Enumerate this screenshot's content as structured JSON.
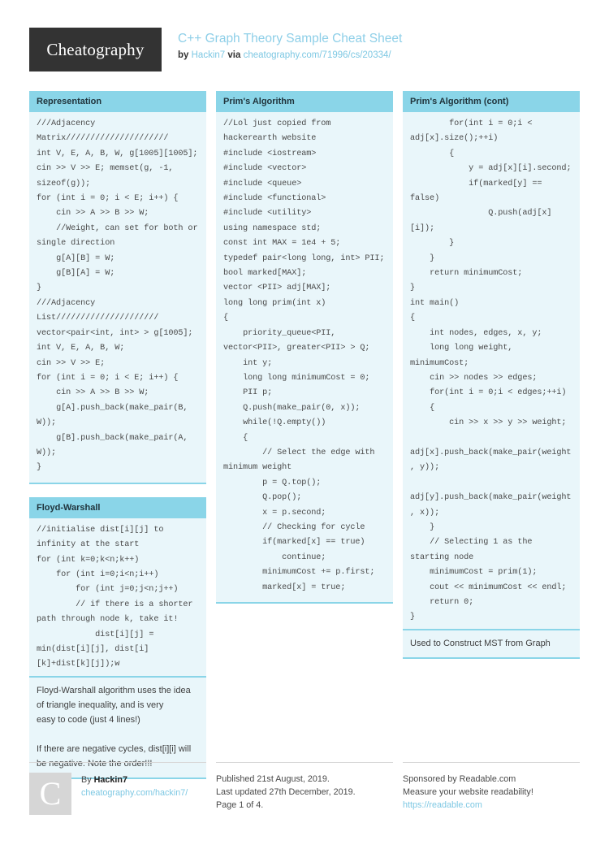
{
  "header": {
    "logo_text": "Cheatography",
    "title": "C++ Graph Theory Sample Cheat Sheet",
    "by_label": "by",
    "author": "Hackin7",
    "via_label": "via",
    "source_url": "cheatography.com/71996/cs/20334/",
    "accent_color": "#8ad5e8",
    "logo_bg": "#333333"
  },
  "columns": [
    {
      "cards": [
        {
          "title": "Representation",
          "code": "///Adjacency Matrix/////////////////////\nint V, E, A, B, W, g[1005][1005];\ncin >> V >> E; memset(g, -1, sizeof(g));\nfor (int i = 0; i < E; i++) {\n    cin >> A >> B >> W;\n    //Weight, can set for both or single direction\n    g[A][B] = W;\n    g[B][A] = W;\n}\n///Adjacency List/////////////////////\nvector<pair<int, int> > g[1005];\nint V, E, A, B, W;\ncin >> V >> E;\nfor (int i = 0; i < E; i++) {\n    cin >> A >> B >> W;\n    g[A].push_back(make_pair(B, W));\n    g[B].push_back(make_pair(A, W));\n}",
          "desc": null
        },
        {
          "title": "Floyd-Warshall",
          "code": "//initialise dist[i][j] to infinity at the start\nfor (int k=0;k<n;k++)\n    for (int i=0;i<n;i++)\n        for (int j=0;j<n;j++)\n        // if there is a shorter path through node k, take it!\n            dist[i][j] = min(dist[i][j], dist[i][k]+dist[k][j]);w",
          "desc": "Floyd-Warshall algorithm uses the idea of triangle inequality, and is very\neasy to code (just 4 lines!)\n\nIf there are negative cycles, dist[i][i] will be negative. Note the order!!!"
        }
      ]
    },
    {
      "cards": [
        {
          "title": "Prim's Algorithm",
          "code": "//Lol just copied from hackerearth website\n#include <iostream>\n#include <vector>\n#include <queue>\n#include <functional>\n#include <utility>\nusing namespace std;\nconst int MAX = 1e4 + 5;\ntypedef pair<long long, int> PII;\nbool marked[MAX];\nvector <PII> adj[MAX];\nlong long prim(int x)\n{\n    priority_queue<PII, vector<PII>, greater<PII> > Q;\n    int y;\n    long long minimumCost = 0;\n    PII p;\n    Q.push(make_pair(0, x));\n    while(!Q.empty())\n    {\n        // Select the edge with minimum weight\n        p = Q.top();\n        Q.pop();\n        x = p.second;\n        // Checking for cycle\n        if(marked[x] == true)\n            continue;\n        minimumCost += p.first;\n        marked[x] = true;",
          "desc": null
        }
      ]
    },
    {
      "cards": [
        {
          "title": "Prim's Algorithm (cont)",
          "code": "        for(int i = 0;i < adj[x].size();++i)\n        {\n            y = adj[x][i].second;\n            if(marked[y] == false)\n                Q.push(adj[x][i]);\n        }\n    }\n    return minimumCost;\n}\nint main()\n{\n    int nodes, edges, x, y;\n    long long weight, minimumCost;\n    cin >> nodes >> edges;\n    for(int i = 0;i < edges;++i)\n    {\n        cin >> x >> y >> weight;\n        adj[x].push_back(make_pair(weight, y));\n        adj[y].push_back(make_pair(weight, x));\n    }\n    // Selecting 1 as the starting node\n    minimumCost = prim(1);\n    cout << minimumCost << endl;\n    return 0;\n}",
          "desc": "Used to Construct MST from Graph"
        }
      ]
    }
  ],
  "footer": {
    "author_block": {
      "avatar_letter": "C",
      "by_label": "By",
      "author": "Hackin7",
      "profile_url": "cheatography.com/hackin7/"
    },
    "publish_block": {
      "published": "Published 21st August, 2019.",
      "updated": "Last updated 27th December, 2019.",
      "page": "Page 1 of 4."
    },
    "sponsor_block": {
      "sponsored_label": "Sponsored by",
      "sponsor_name": "Readable.com",
      "tagline": "Measure your website readability!",
      "sponsor_url": "https://readable.com"
    }
  }
}
